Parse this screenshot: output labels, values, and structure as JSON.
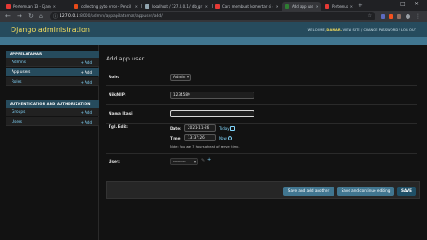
{
  "browser": {
    "tabs": [
      {
        "title": "Pertemuan 13 - Django D",
        "active": false,
        "fav_color": "#e53935"
      },
      {
        "title": "collecting pyto error - Pencil",
        "active": false,
        "fav_color": "#e64a19"
      },
      {
        "title": "localhost / 127.0.0.1 / db_gr",
        "active": false,
        "fav_color": "#90a4ae"
      },
      {
        "title": "Cara membuat komentar di d",
        "active": false,
        "fav_color": "#e53935"
      },
      {
        "title": "Add app user | Django site a",
        "active": true,
        "fav_color": "#2e7d32"
      },
      {
        "title": "Pertemuan 13 - Django rlv",
        "active": false,
        "fav_color": "#e53935"
      }
    ],
    "new_tab": "+",
    "url_host": "127.0.0.1",
    "url_path": ":8000/admin/appapilatamar/appuser/add/",
    "window_controls": [
      "–",
      "□",
      "✕"
    ]
  },
  "header": {
    "site_title": "Django administration",
    "welcome": "WELCOME,",
    "username": "DAMAR.",
    "links": "VIEW SITE / CHANGE PASSWORD / LOG OUT"
  },
  "breadcrumbs": "Home › Appapilatamar › App users › Add app user",
  "sidebar": {
    "modules": [
      {
        "caption": "APPPELATAMAR",
        "rows": [
          {
            "label": "Admins",
            "add": "+ Add",
            "selected": false
          },
          {
            "label": "App users",
            "add": "+ Add",
            "selected": true
          },
          {
            "label": "Roles",
            "add": "+ Add",
            "selected": false
          }
        ]
      },
      {
        "caption": "AUTHENTICATION AND AUTHORIZATION",
        "rows": [
          {
            "label": "Groups",
            "add": "+ Add",
            "selected": false
          },
          {
            "label": "Users",
            "add": "+ Add",
            "selected": false
          }
        ]
      }
    ]
  },
  "content": {
    "title": "Add app user",
    "fields": {
      "role_label": "Role:",
      "role_value": "Admin",
      "nik_label": "Nik/NIP:",
      "nik_value": "1234589",
      "nama_label": "Nama lkasi:",
      "nama_value": "",
      "tgl_label": "Tgl. Edit:",
      "date_label": "Date:",
      "date_value": "2021-11-26",
      "date_shortcut": "Today |",
      "time_label": "Time:",
      "time_value": "13:37:26",
      "time_shortcut": "Now |",
      "tz_note": "Note: You are 7 hours ahead of server time.",
      "user_label": "User:",
      "user_value": "---------"
    },
    "buttons": {
      "save_add": "Save and add another",
      "save_continue": "Save and continue editing",
      "save": "SAVE"
    }
  },
  "colors": {
    "header_bg": "#264b5d",
    "breadcrumb_bg": "#417690",
    "title_yellow": "#f5dd5d",
    "link_blue": "#81d4fa"
  }
}
